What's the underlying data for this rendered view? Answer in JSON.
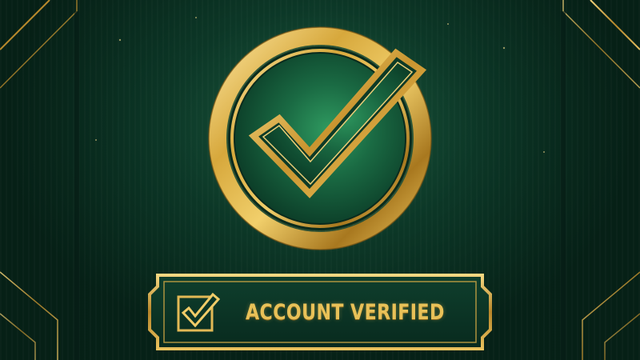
{
  "screen": {
    "name": "account-verified-confirmation"
  },
  "emblem": {
    "icon": "verified-checkmark-icon",
    "shape": "gold ring with checkmark on green field"
  },
  "banner": {
    "icon": "checkbox-checked-icon",
    "label": "ACCOUNT VERIFIED"
  },
  "colors": {
    "background": "#0b3326",
    "gold": "#d4a93a",
    "gold_light": "#f4d675",
    "gold_dark": "#8a6418",
    "emblem_green": "#1f7a4d"
  }
}
